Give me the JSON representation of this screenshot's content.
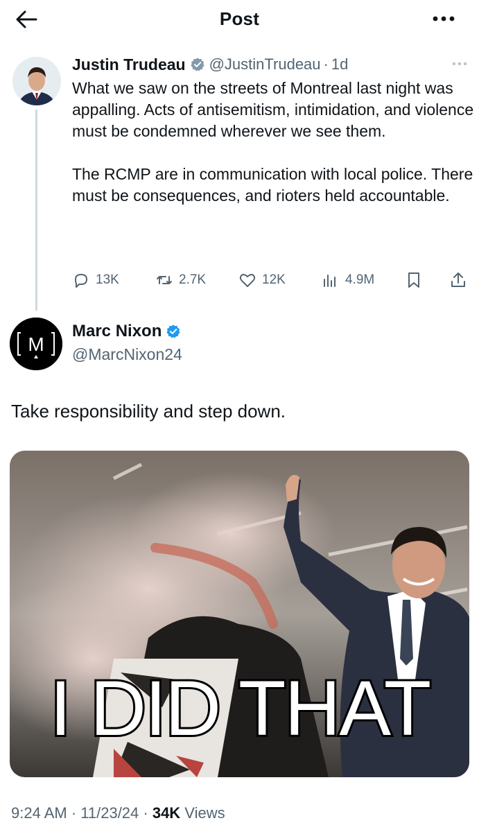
{
  "header": {
    "title": "Post"
  },
  "parent_tweet": {
    "display_name": "Justin Trudeau",
    "handle": "@JustinTrudeau",
    "separator": "·",
    "time": "1d",
    "text": "What we saw on the streets of Montreal last night was appalling. Acts of antisemitism, intimidation, and violence must be condemned wherever we see them.\n\nThe RCMP are in communication with local police. There must be consequences, and rioters held accountable.",
    "verified_color": "#829aab",
    "stats": {
      "replies": "13K",
      "reposts": "2.7K",
      "likes": "12K",
      "views": "4.9M"
    }
  },
  "reply_tweet": {
    "display_name": "Marc Nixon",
    "handle": "@MarcNixon24",
    "verified_color": "#1d9bf0",
    "avatar_letter": "M",
    "text": "Take responsibility and step down.",
    "media_caption": "I DID THAT",
    "timestamp": "9:24 AM · 11/23/24 · ",
    "views_count": "34K",
    "views_label": " Views"
  },
  "colors": {
    "secondary_text": "#536471",
    "primary_text": "#0f1419",
    "accent": "#1d9bf0",
    "thread_line": "#cfd9de"
  }
}
